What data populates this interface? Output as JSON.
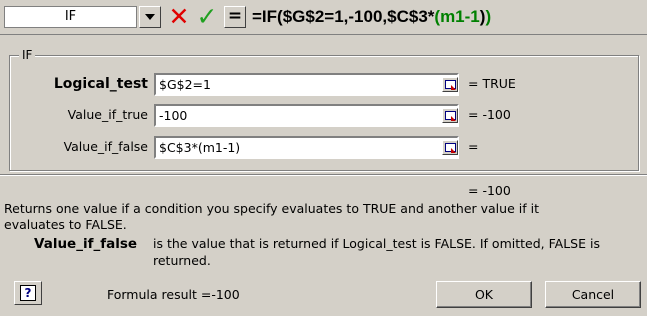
{
  "formula_bar": {
    "name_box": "IF",
    "cancel_glyph": "✕",
    "enter_glyph": "✓",
    "edit_formula_glyph": "=",
    "formula_black": "=IF($G$2=1,-100,$C$3*",
    "formula_green": "(m1-1",
    "formula_end": ")",
    "formula_close_green": ")"
  },
  "dialog": {
    "group_title": "IF",
    "arguments": [
      {
        "label": "Logical_test",
        "value": "$G$2=1",
        "result": "= TRUE"
      },
      {
        "label": "Value_if_true",
        "value": "-100",
        "result": "= -100"
      },
      {
        "label": "Value_if_false",
        "value": "$C$3*(m1-1)",
        "result": "="
      }
    ],
    "overall_result": "= -100",
    "description_line1": "Returns one value if a condition you specify evaluates to TRUE and another value if it",
    "description_line2": "evaluates to FALSE.",
    "arg_help_name": "Value_if_false",
    "arg_help_line1": "is the value that is returned if Logical_test is FALSE. If omitted, FALSE is",
    "arg_help_line2": "returned.",
    "help_glyph": "?",
    "formula_result": "Formula result =-100",
    "ok_label": "OK",
    "cancel_label": "Cancel"
  },
  "colors": {
    "cancel_red": "#e00000",
    "enter_green": "#20a020",
    "paren_green": "#008000"
  }
}
